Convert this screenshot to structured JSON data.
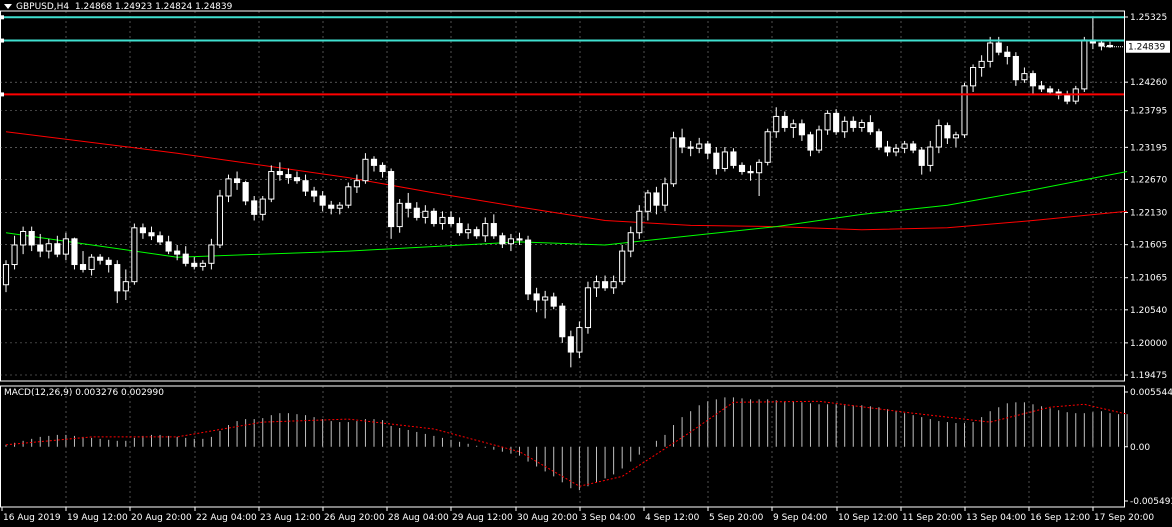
{
  "header": {
    "symbol_timeframe": "GBPUSD,H4",
    "ohlc": "1.24868 1.24923 1.24824 1.24839"
  },
  "macd_header": {
    "label": "MACD(12,26,9)",
    "values": "0.003276 0.002990"
  },
  "colors": {
    "background": "#000000",
    "grid": "#c0c0c0",
    "bull_candle": "#000000",
    "bear_candle": "#ffffff",
    "wick": "#ffffff",
    "ma_fast": "#00ff00",
    "ma_slow": "#ff0000",
    "hline_cyan": "#40e0d0",
    "hline_red": "#ff0000",
    "macd_hist": "#c0c0c0",
    "macd_signal": "#ff0000"
  },
  "chart_data": [
    {
      "type": "candlestick",
      "title": "GBPUSD,H4",
      "y_ticks": [
        "1.25325",
        "1.24839",
        "1.24260",
        "1.23795",
        "1.23195",
        "1.22670",
        "1.22130",
        "1.21605",
        "1.21065",
        "1.20540",
        "1.20000",
        "1.19475"
      ],
      "ylim": [
        1.19475,
        1.25325
      ],
      "current_price": "1.24839",
      "x_ticks": [
        "16 Aug 2019",
        "19 Aug 12:00",
        "20 Aug 20:00",
        "22 Aug 04:00",
        "23 Aug 12:00",
        "26 Aug 20:00",
        "28 Aug 04:00",
        "29 Aug 12:00",
        "30 Aug 20:00",
        "3 Sep 04:00",
        "4 Sep 12:00",
        "5 Sep 20:00",
        "9 Sep 04:00",
        "10 Sep 12:00",
        "11 Sep 20:00",
        "13 Sep 04:00",
        "16 Sep 12:00",
        "17 Sep 20:00"
      ],
      "horizontal_lines": [
        {
          "price": 1.2532,
          "color": "cyan"
        },
        {
          "price": 1.2494,
          "color": "cyan"
        },
        {
          "price": 1.2406,
          "color": "red"
        }
      ],
      "candles": [
        [
          1.2095,
          1.2135,
          1.2083,
          1.2128
        ],
        [
          1.2128,
          1.2175,
          1.212,
          1.216
        ],
        [
          1.216,
          1.219,
          1.2145,
          1.2182
        ],
        [
          1.2182,
          1.219,
          1.215,
          1.216
        ],
        [
          1.216,
          1.2178,
          1.214,
          1.215
        ],
        [
          1.215,
          1.217,
          1.2138,
          1.2162
        ],
        [
          1.2162,
          1.2175,
          1.214,
          1.2145
        ],
        [
          1.2145,
          1.218,
          1.2135,
          1.217
        ],
        [
          1.217,
          1.2172,
          1.212,
          1.2128
        ],
        [
          1.2128,
          1.215,
          1.2115,
          1.212
        ],
        [
          1.212,
          1.2145,
          1.211,
          1.214
        ],
        [
          1.214,
          1.2145,
          1.2128,
          1.2135
        ],
        [
          1.2135,
          1.214,
          1.2115,
          1.2128
        ],
        [
          1.2128,
          1.2135,
          1.2065,
          1.2085
        ],
        [
          1.2085,
          1.212,
          1.207,
          1.21
        ],
        [
          1.21,
          1.2195,
          1.2095,
          1.2188
        ],
        [
          1.2188,
          1.2195,
          1.217,
          1.218
        ],
        [
          1.218,
          1.219,
          1.2168,
          1.2175
        ],
        [
          1.2175,
          1.2182,
          1.216,
          1.2165
        ],
        [
          1.2165,
          1.2175,
          1.2145,
          1.215
        ],
        [
          1.215,
          1.216,
          1.2135,
          1.2145
        ],
        [
          1.2145,
          1.2158,
          1.2125,
          1.213
        ],
        [
          1.213,
          1.214,
          1.212,
          1.2125
        ],
        [
          1.2125,
          1.2135,
          1.2118,
          1.213
        ],
        [
          1.213,
          1.217,
          1.212,
          1.216
        ],
        [
          1.216,
          1.225,
          1.2155,
          1.224
        ],
        [
          1.224,
          1.2275,
          1.223,
          1.2268
        ],
        [
          1.2268,
          1.228,
          1.225,
          1.2262
        ],
        [
          1.2262,
          1.2265,
          1.2225,
          1.2232
        ],
        [
          1.2232,
          1.224,
          1.22,
          1.221
        ],
        [
          1.221,
          1.224,
          1.22,
          1.2235
        ],
        [
          1.2235,
          1.229,
          1.223,
          1.228
        ],
        [
          1.228,
          1.2295,
          1.2265,
          1.2275
        ],
        [
          1.2275,
          1.2285,
          1.226,
          1.227
        ],
        [
          1.227,
          1.228,
          1.226,
          1.2265
        ],
        [
          1.2265,
          1.2275,
          1.224,
          1.2248
        ],
        [
          1.2248,
          1.2255,
          1.223,
          1.224
        ],
        [
          1.224,
          1.2248,
          1.2215,
          1.2225
        ],
        [
          1.2225,
          1.2232,
          1.221,
          1.222
        ],
        [
          1.222,
          1.223,
          1.221,
          1.2225
        ],
        [
          1.2225,
          1.2262,
          1.222,
          1.2255
        ],
        [
          1.2255,
          1.2275,
          1.2245,
          1.2265
        ],
        [
          1.2265,
          1.231,
          1.226,
          1.23
        ],
        [
          1.23,
          1.2305,
          1.228,
          1.229
        ],
        [
          1.229,
          1.2295,
          1.227,
          1.228
        ],
        [
          1.228,
          1.2285,
          1.217,
          1.219
        ],
        [
          1.219,
          1.2235,
          1.218,
          1.2228
        ],
        [
          1.2228,
          1.2245,
          1.2205,
          1.222
        ],
        [
          1.222,
          1.223,
          1.22,
          1.2205
        ],
        [
          1.2205,
          1.2225,
          1.2195,
          1.2215
        ],
        [
          1.2215,
          1.222,
          1.219,
          1.2195
        ],
        [
          1.2195,
          1.2215,
          1.2185,
          1.2205
        ],
        [
          1.2205,
          1.2215,
          1.219,
          1.2195
        ],
        [
          1.2195,
          1.2205,
          1.2175,
          1.218
        ],
        [
          1.218,
          1.2195,
          1.217,
          1.2185
        ],
        [
          1.2185,
          1.219,
          1.217,
          1.2175
        ],
        [
          1.2175,
          1.2205,
          1.2165,
          1.2195
        ],
        [
          1.2195,
          1.221,
          1.217,
          1.2175
        ],
        [
          1.2175,
          1.218,
          1.2155,
          1.2162
        ],
        [
          1.2162,
          1.2178,
          1.215,
          1.217
        ],
        [
          1.217,
          1.218,
          1.216,
          1.2168
        ],
        [
          1.2168,
          1.2175,
          1.207,
          1.208
        ],
        [
          1.208,
          1.209,
          1.205,
          1.207
        ],
        [
          1.207,
          1.2085,
          1.204,
          1.2075
        ],
        [
          1.2075,
          1.2082,
          1.2055,
          1.206
        ],
        [
          1.206,
          1.2065,
          1.2,
          1.201
        ],
        [
          1.201,
          1.202,
          1.196,
          1.1985
        ],
        [
          1.1985,
          1.2035,
          1.1975,
          1.2025
        ],
        [
          1.2025,
          1.21,
          1.2015,
          1.209
        ],
        [
          1.209,
          1.211,
          1.2075,
          1.21
        ],
        [
          1.21,
          1.211,
          1.2085,
          1.209
        ],
        [
          1.209,
          1.211,
          1.208,
          1.21
        ],
        [
          1.21,
          1.216,
          1.2095,
          1.215
        ],
        [
          1.215,
          1.219,
          1.214,
          1.218
        ],
        [
          1.218,
          1.2225,
          1.217,
          1.2215
        ],
        [
          1.2215,
          1.225,
          1.22,
          1.2245
        ],
        [
          1.2245,
          1.2255,
          1.221,
          1.2225
        ],
        [
          1.2225,
          1.227,
          1.2215,
          1.226
        ],
        [
          1.226,
          1.2345,
          1.2255,
          1.2335
        ],
        [
          1.2335,
          1.235,
          1.231,
          1.232
        ],
        [
          1.232,
          1.233,
          1.2305,
          1.2318
        ],
        [
          1.2318,
          1.2335,
          1.231,
          1.2325
        ],
        [
          1.2325,
          1.233,
          1.23,
          1.231
        ],
        [
          1.231,
          1.232,
          1.2275,
          1.2285
        ],
        [
          1.2285,
          1.232,
          1.228,
          1.2312
        ],
        [
          1.2312,
          1.2318,
          1.2285,
          1.229
        ],
        [
          1.229,
          1.2295,
          1.2275,
          1.228
        ],
        [
          1.228,
          1.229,
          1.2265,
          1.2278
        ],
        [
          1.2278,
          1.23,
          1.224,
          1.2295
        ],
        [
          1.2295,
          1.235,
          1.229,
          1.2345
        ],
        [
          1.2345,
          1.2385,
          1.2335,
          1.237
        ],
        [
          1.237,
          1.2378,
          1.2345,
          1.2352
        ],
        [
          1.2352,
          1.2365,
          1.2335,
          1.2358
        ],
        [
          1.2358,
          1.2365,
          1.233,
          1.234
        ],
        [
          1.234,
          1.2345,
          1.2305,
          1.2315
        ],
        [
          1.2315,
          1.2355,
          1.231,
          1.2348
        ],
        [
          1.2348,
          1.238,
          1.234,
          1.2375
        ],
        [
          1.2375,
          1.2382,
          1.234,
          1.2345
        ],
        [
          1.2345,
          1.237,
          1.2335,
          1.2362
        ],
        [
          1.2362,
          1.237,
          1.2345,
          1.2352
        ],
        [
          1.2352,
          1.2365,
          1.2345,
          1.236
        ],
        [
          1.236,
          1.2372,
          1.234,
          1.2345
        ],
        [
          1.2345,
          1.235,
          1.2315,
          1.232
        ],
        [
          1.232,
          1.233,
          1.2305,
          1.2312
        ],
        [
          1.2312,
          1.2325,
          1.2305,
          1.2318
        ],
        [
          1.2318,
          1.233,
          1.231,
          1.2325
        ],
        [
          1.2325,
          1.233,
          1.231,
          1.2315
        ],
        [
          1.2315,
          1.232,
          1.2275,
          1.229
        ],
        [
          1.229,
          1.233,
          1.228,
          1.232
        ],
        [
          1.232,
          1.2365,
          1.231,
          1.2355
        ],
        [
          1.2355,
          1.236,
          1.2325,
          1.2335
        ],
        [
          1.2335,
          1.2345,
          1.232,
          1.234
        ],
        [
          1.234,
          1.2425,
          1.2335,
          1.242
        ],
        [
          1.242,
          1.2455,
          1.241,
          1.245
        ],
        [
          1.245,
          1.247,
          1.2435,
          1.246
        ],
        [
          1.246,
          1.25,
          1.245,
          1.249
        ],
        [
          1.249,
          1.25,
          1.247,
          1.2475
        ],
        [
          1.2475,
          1.2485,
          1.2455,
          1.2468
        ],
        [
          1.2468,
          1.2475,
          1.242,
          1.243
        ],
        [
          1.243,
          1.245,
          1.2425,
          1.244
        ],
        [
          1.244,
          1.2445,
          1.2405,
          1.242
        ],
        [
          1.242,
          1.2428,
          1.241,
          1.2415
        ],
        [
          1.2415,
          1.242,
          1.2405,
          1.241
        ],
        [
          1.241,
          1.2415,
          1.2398,
          1.2405
        ],
        [
          1.2405,
          1.2412,
          1.239,
          1.2395
        ],
        [
          1.2395,
          1.242,
          1.239,
          1.2415
        ],
        [
          1.2415,
          1.25,
          1.241,
          1.2495
        ],
        [
          1.2495,
          1.2532,
          1.248,
          1.249
        ],
        [
          1.249,
          1.2495,
          1.2478,
          1.2485
        ],
        [
          1.2486,
          1.2492,
          1.2482,
          1.2484
        ]
      ],
      "ma_fast_label": "",
      "ma_fast": [
        [
          0,
          1.218
        ],
        [
          20,
          1.214
        ],
        [
          40,
          1.215
        ],
        [
          60,
          1.2165
        ],
        [
          70,
          1.216
        ],
        [
          80,
          1.2175
        ],
        [
          90,
          1.219
        ],
        [
          100,
          1.221
        ],
        [
          110,
          1.2225
        ],
        [
          120,
          1.225
        ],
        [
          131,
          1.228
        ]
      ],
      "ma_slow_label": "",
      "ma_slow": [
        [
          0,
          1.2345
        ],
        [
          20,
          1.231
        ],
        [
          40,
          1.227
        ],
        [
          50,
          1.2245
        ],
        [
          60,
          1.2222
        ],
        [
          70,
          1.22
        ],
        [
          80,
          1.2192
        ],
        [
          90,
          1.219
        ],
        [
          100,
          1.2185
        ],
        [
          110,
          1.2188
        ],
        [
          120,
          1.22
        ],
        [
          131,
          1.2215
        ]
      ]
    },
    {
      "type": "macd",
      "title": "MACD(12,26,9)",
      "y_ticks": [
        "0.005544",
        "0.00",
        "-0.005493"
      ],
      "ylim": [
        -0.005493,
        0.005544
      ],
      "histogram": [
        0.0002,
        0.0004,
        0.0006,
        0.0008,
        0.001,
        0.0011,
        0.0012,
        0.0012,
        0.0011,
        0.001,
        0.0009,
        0.0008,
        0.0007,
        0.0006,
        0.0006,
        0.0009,
        0.0011,
        0.0012,
        0.0012,
        0.0011,
        0.001,
        0.0009,
        0.0008,
        0.0008,
        0.001,
        0.0016,
        0.0022,
        0.0026,
        0.0028,
        0.0028,
        0.0029,
        0.0032,
        0.0034,
        0.0034,
        0.0033,
        0.0032,
        0.003,
        0.0028,
        0.0026,
        0.0025,
        0.0025,
        0.0026,
        0.0028,
        0.0028,
        0.0027,
        0.0021,
        0.0019,
        0.0017,
        0.0015,
        0.0013,
        0.0011,
        0.0009,
        0.0007,
        0.0005,
        0.0003,
        0.0001,
        -0.0001,
        -0.0003,
        -0.0005,
        -0.0007,
        -0.0009,
        -0.0015,
        -0.002,
        -0.0025,
        -0.003,
        -0.0036,
        -0.0042,
        -0.0044,
        -0.004,
        -0.0036,
        -0.0032,
        -0.0028,
        -0.0022,
        -0.0015,
        -0.0008,
        0.0,
        0.0006,
        0.0012,
        0.0022,
        0.003,
        0.0036,
        0.0042,
        0.0046,
        0.0048,
        0.005,
        0.005,
        0.0049,
        0.0048,
        0.0048,
        0.0048,
        0.0047,
        0.0046,
        0.0046,
        0.0045,
        0.0044,
        0.0043,
        0.0043,
        0.0043,
        0.0042,
        0.0042,
        0.0042,
        0.0041,
        0.004,
        0.0038,
        0.0036,
        0.0034,
        0.0032,
        0.003,
        0.0028,
        0.0026,
        0.0025,
        0.0024,
        0.0024,
        0.0025,
        0.003,
        0.0036,
        0.004,
        0.0044,
        0.0045,
        0.0045,
        0.0043,
        0.0041,
        0.0039,
        0.0037,
        0.0035,
        0.0034,
        0.0034,
        0.0035,
        0.0036,
        0.0034,
        0.0033,
        0.0033
      ],
      "signal": [
        [
          0,
          0.0002
        ],
        [
          10,
          0.001
        ],
        [
          20,
          0.001
        ],
        [
          30,
          0.0025
        ],
        [
          40,
          0.0028
        ],
        [
          50,
          0.0018
        ],
        [
          60,
          -0.0005
        ],
        [
          67,
          -0.004
        ],
        [
          72,
          -0.003
        ],
        [
          80,
          0.0015
        ],
        [
          85,
          0.0045
        ],
        [
          95,
          0.0046
        ],
        [
          105,
          0.0035
        ],
        [
          115,
          0.0025
        ],
        [
          122,
          0.004
        ],
        [
          126,
          0.0043
        ],
        [
          131,
          0.0033
        ]
      ]
    }
  ]
}
